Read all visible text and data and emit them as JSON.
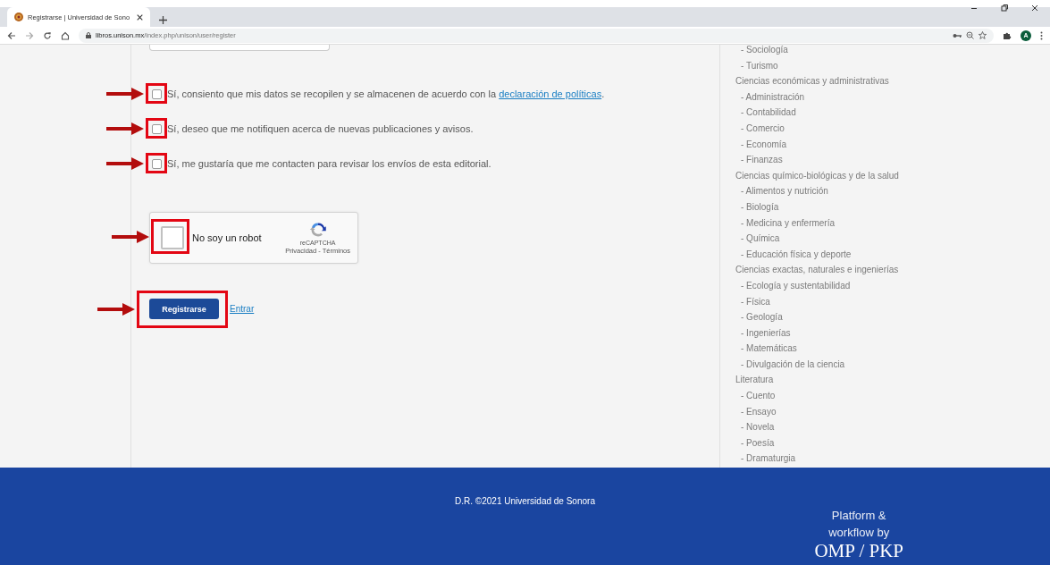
{
  "browser": {
    "tab": {
      "title": "Registrarse | Universidad de Sono",
      "selected": true
    },
    "address": {
      "host": "libros.unison.mx",
      "path": "/index.php/unison/user/register"
    },
    "profile_initial": "A"
  },
  "consents": [
    {
      "text": "Sí, consiento que mis datos se recopilen y se almacenen de acuerdo con la ",
      "link": "declaración de políticas",
      "after": ".",
      "checked": false,
      "highlighted": true
    },
    {
      "text": "Sí, deseo que me notifiquen acerca de nuevas publicaciones y avisos.",
      "checked": false,
      "highlighted": true
    },
    {
      "text": "Sí, me gustaría que me contacten para revisar los envíos de esta editorial.",
      "checked": false,
      "highlighted": true
    }
  ],
  "captcha": {
    "label": "No soy un robot",
    "brand": "reCAPTCHA",
    "links": "Privacidad - Términos",
    "checked": false,
    "highlighted": true
  },
  "actions": {
    "submit": "Registrarse",
    "login_link": "Entrar",
    "highlighted": true
  },
  "sidebar": {
    "groups": [
      {
        "children": [
          {
            "label": "- Sociología"
          },
          {
            "label": "- Turismo"
          }
        ]
      },
      {
        "label": "Ciencias económicas y administrativas",
        "children": [
          {
            "label": "- Administración"
          },
          {
            "label": "- Contabilidad"
          },
          {
            "label": "- Comercio"
          },
          {
            "label": "- Economía"
          },
          {
            "label": "- Finanzas"
          }
        ]
      },
      {
        "label": "Ciencias químico-biológicas y de la salud",
        "children": [
          {
            "label": "- Alimentos y nutrición"
          },
          {
            "label": "- Biología"
          },
          {
            "label": "- Medicina y enfermería"
          },
          {
            "label": "- Química"
          },
          {
            "label": "- Educación física y deporte"
          }
        ]
      },
      {
        "label": "Ciencias exactas, naturales e ingenierías",
        "children": [
          {
            "label": "- Ecología y sustentabilidad"
          },
          {
            "label": "- Física"
          },
          {
            "label": "- Geología"
          },
          {
            "label": "- Ingenierías"
          },
          {
            "label": "- Matemáticas"
          },
          {
            "label": "- Divulgación de la ciencia"
          }
        ]
      },
      {
        "label": "Literatura",
        "children": [
          {
            "label": "- Cuento"
          },
          {
            "label": "- Ensayo"
          },
          {
            "label": "- Novela"
          },
          {
            "label": "- Poesía"
          },
          {
            "label": "- Dramaturgia"
          }
        ]
      }
    ]
  },
  "footer": {
    "copyright": "D.R. ©2021 Universidad de Sonora",
    "platform": "Platform & workflow by",
    "logo": "OMP / PKP"
  }
}
